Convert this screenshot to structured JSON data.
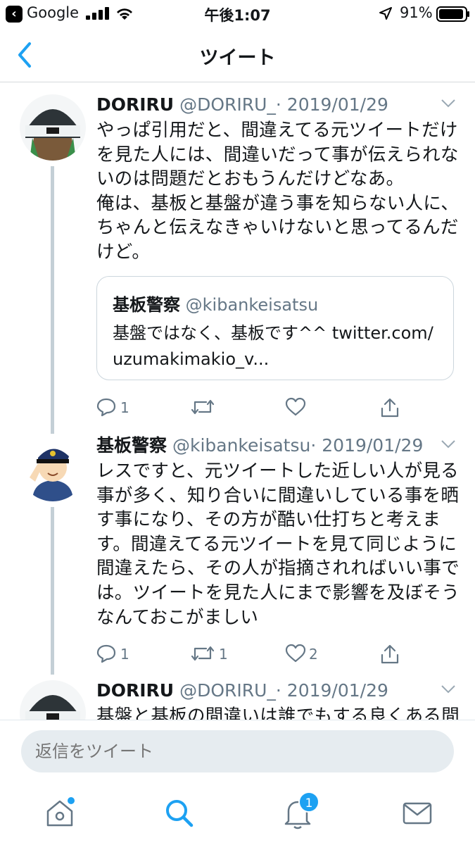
{
  "status_bar": {
    "back_app": "Google",
    "time": "午後1:07",
    "battery": "91%"
  },
  "nav": {
    "title": "ツイート"
  },
  "tweets": [
    {
      "name": "DORIRU",
      "handle": "@DORIRU_",
      "date": "· 2019/01/29",
      "text": "やっぱ引用だと、間違えてる元ツイートだけ\nを見た人には、間違いだって事が伝えられな\nいのは問題だとおもうんだけどなあ。\n俺は、基板と基盤が違う事を知らない人に、\nちゃんと伝えなきゃいけないと思ってるんだ\nけど。",
      "quote": {
        "name": "基板警察",
        "handle": "@kibankeisatsu",
        "text": "基盤ではなく、基板です^^ twitter.com/\nuzumakimakio_v..."
      },
      "replies": "1",
      "retweets": "",
      "likes": ""
    },
    {
      "name": "基板警察",
      "handle": "@kibankeisatsu",
      "date": "· 2019/01/29",
      "text": "レスですと、元ツイートした近しい人が見る\n事が多く、知り合いに間違いしている事を晒\nす事になり、その方が酷い仕打ちと考えま\nす。間違えてる元ツイートを見て同じように\n間違えたら、その人が指摘されればいい事で\nは。ツイートを見た人にまで影響を及ぼそう\nなんておこがましい",
      "replies": "1",
      "retweets": "1",
      "likes": "2"
    },
    {
      "name": "DORIRU",
      "handle": "@DORIRU_",
      "date": "· 2019/01/29",
      "text": "基盤と基板の間違いは誰でもする良くある間"
    }
  ],
  "reply": {
    "placeholder": "返信をツイート"
  },
  "tabs": {
    "notifications_badge": "1"
  },
  "colors": {
    "accent": "#1da1f2",
    "secondary_text": "#657786",
    "thread_line": "#c4cfd6"
  }
}
